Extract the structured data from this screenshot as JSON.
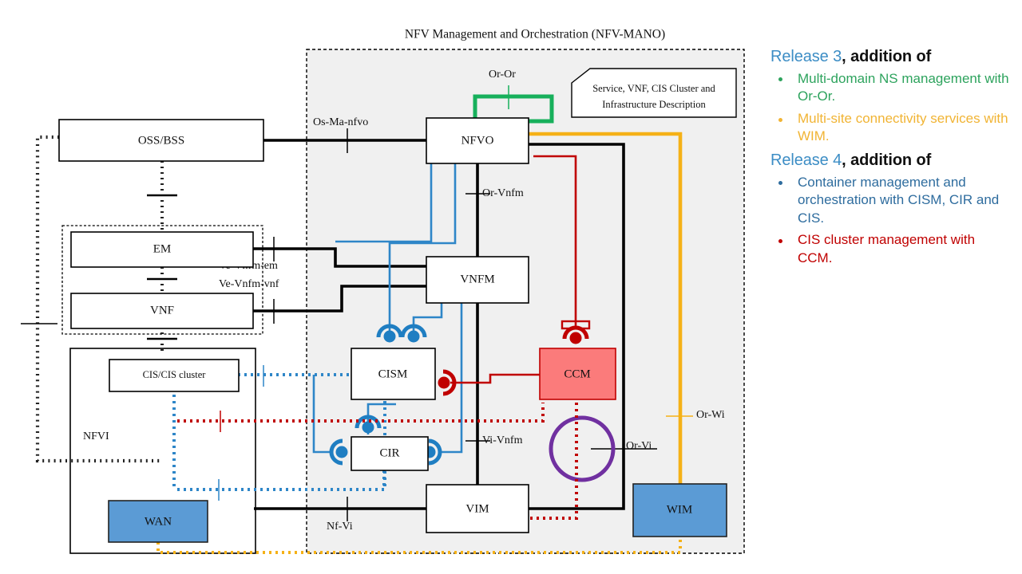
{
  "diagram": {
    "title": "NFV Management and Orchestration (NFV-MANO)",
    "areas": {
      "nfvi_label": "NFVI"
    },
    "boxes": {
      "ossbss": "OSS/BSS",
      "em": "EM",
      "vnf": "VNF",
      "cis_cluster": "CIS/CIS  cluster",
      "wan": "WAN",
      "nfvo": "NFVO",
      "vnfm": "VNFM",
      "cism": "CISM",
      "cir": "CIR",
      "ccm": "CCM",
      "vim": "VIM",
      "wim": "WIM",
      "description_line1": "Service, VNF, CIS Cluster and",
      "description_line2": "Infrastructure Description"
    },
    "reference_points": {
      "or_or": "Or-Or",
      "os_ma_nfvo": "Os-Ma-nfvo",
      "or_vnfm": "Or-Vnfm",
      "ve_vnfm_em": "Ve-Vnfm-em",
      "ve_vnfm_vnf": "Ve-Vnfm-vnf",
      "vi_vnfm": "Vi-Vnfm",
      "nf_vi": "Nf-Vi",
      "or_vi": "Or-Vi",
      "or_wi": "Or-Wi"
    },
    "colors": {
      "mano_fill": "#F0F0F0",
      "mano_border": "#000000",
      "black": "#000000",
      "green": "#17B05B",
      "yellow": "#F5B117",
      "blue": "#1F7EC2",
      "red": "#C00000",
      "ccm_fill": "#FB7B7B",
      "purple": "#7030A0",
      "wan_fill": "#5B9BD5",
      "wim_fill": "#5B9BD5"
    }
  },
  "legend": {
    "releases": [
      {
        "id": "release-3",
        "name": "Release 3",
        "suffix": ", addition of",
        "name_color": "#3C8DC5",
        "items": [
          {
            "text": "Multi-domain NS management with Or-Or.",
            "color": "#2DA35D"
          },
          {
            "text": "Multi-site connectivity services with WIM.",
            "color": "#F1B434"
          }
        ]
      },
      {
        "id": "release-4",
        "name": "Release 4",
        "suffix": ", addition of",
        "name_color": "#3C8DC5",
        "items": [
          {
            "text": "Container management and orchestration with CISM, CIR and CIS.",
            "color": "#2E6C9E"
          },
          {
            "text": "CIS cluster management with CCM.",
            "color": "#C00000"
          }
        ]
      }
    ]
  }
}
